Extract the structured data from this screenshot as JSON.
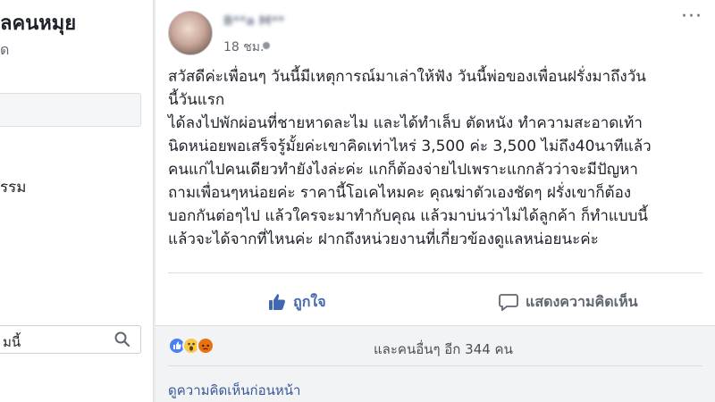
{
  "sidebar": {
    "title": "ลคนหมุย",
    "subtitle": "ด",
    "item": "รรม",
    "search_value": "มนี้"
  },
  "post": {
    "author": "B**a M**",
    "time": "18 ชม.",
    "more": "···",
    "lines": [
      "สวัสดีค่ะเพื่อนๆ วันนี้มีเหตุการณ์มาเล่าให้ฟัง วันนี้พ่อของเพื่อนฝรั่งมาถึงวัน",
      "นี้วันแรก",
      "ได้ลงไปพักผ่อนที่ชายหาดละไม และได้ทำเล็บ ตัดหนัง ทำความสะอาดเท้า",
      "นิดหน่อยพอเสร็จรู้มั้ยค่ะเขาคิดเท่าไหร่ 3,500 ค่ะ 3,500 ไม่ถึง40นาทีแล้ว",
      "คนแก่ไปคนเดียวทำยังไงล่ะค่ะ แกก็ต้องจ่ายไปเพราะแกกลัวว่าจะมีปัญหา",
      "ถามเพื่อนๆหน่อยค่ะ ราคานี้โอเคไหมคะ คุณฆ่าตัวเองชัดๆ ฝรั่งเขาก็ต้อง",
      "บอกกันต่อๆไป แล้วใครจะมาทำกับคุณ แล้วมาบ่นว่าไม่ได้ลูกค้า ก็ทำแบบนี้",
      "แล้วจะได้จากที่ไหนค่ะ ฝากถึงหน่วยงานที่เกี่ยวข้องดูแลหน่อยนะค่ะ"
    ],
    "like_label": "ถูกใจ",
    "comment_label": "แสดงความคิดเห็น",
    "reactions_text": "และคนอื่นๆ อีก 344 คน",
    "view_previous": "ดูความคิดเห็นก่อนหน้า"
  },
  "colors": {
    "link_blue": "#4267b2",
    "text": "#1d2129",
    "muted": "#606770"
  },
  "icons": [
    "search-icon",
    "like-icon",
    "comment-icon",
    "like-reaction-icon",
    "wow-reaction-icon",
    "angry-reaction-icon"
  ]
}
